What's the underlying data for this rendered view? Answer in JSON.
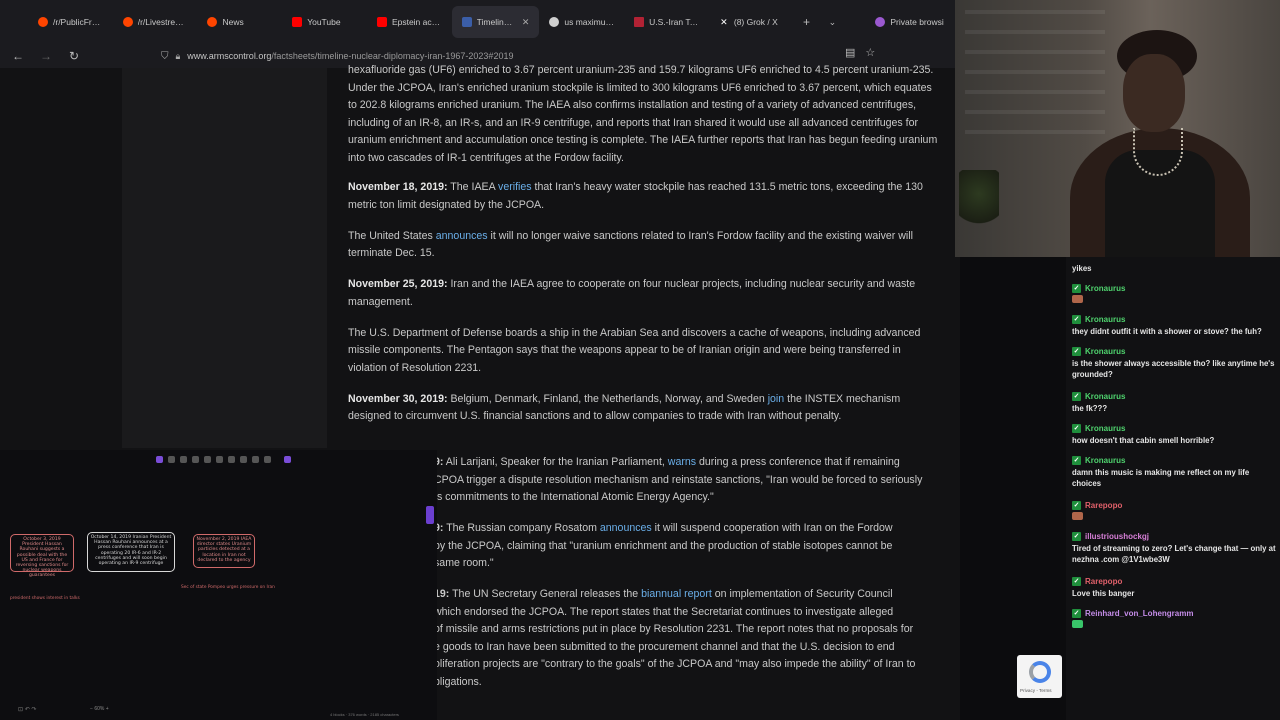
{
  "tabs": [
    {
      "label": "/r/PublicFreakout",
      "color": "#ff4500",
      "active": false
    },
    {
      "label": "/r/LivestreamFail",
      "color": "#ff4500",
      "active": false
    },
    {
      "label": "News",
      "color": "#ff4500",
      "active": false
    },
    {
      "label": "YouTube",
      "color": "#ff0000",
      "active": false
    },
    {
      "label": "Epstein accuser",
      "color": "#ff0000",
      "active": false
    },
    {
      "label": "Timeline of N",
      "color": "#3b5ea8",
      "active": true
    },
    {
      "label": "us maximum pr",
      "color": "#cfcfcf",
      "active": false
    },
    {
      "label": "U.S.-Iran Tensio",
      "color": "#b22234",
      "active": false
    },
    {
      "label": "(8) Grok / X",
      "color": "#ffffff",
      "active": false
    }
  ],
  "private_label": "Private browsi",
  "url": {
    "domain": "www.armscontrol.org",
    "path": "/factsheets/timeline-nuclear-diplomacy-iran-1967-2023#2019"
  },
  "article": {
    "p0": "hexafluoride gas (UF6) enriched to 3.67 percent uranium-235 and 159.7 kilograms UF6 enriched to 4.5 percent uranium-235. Under the JCPOA, Iran's enriched uranium stockpile is limited to 300 kilograms UF6 enriched to 3.67 percent, which equates to 202.8 kilograms enriched uranium. The IAEA also confirms installation and testing of a variety of advanced centrifuges, including of an IR-8, an IR-s, and an IR-9 centrifuge, and reports that Iran shared it would use all advanced centrifuges for uranium enrichment and accumulation once testing is complete. The IAEA further reports that Iran has begun feeding uranium into two cascades of IR-1 centrifuges at the Fordow facility.",
    "p1_date": "November 18, 2019:",
    "p1_a": "The IAEA",
    "p1_link": "verifies",
    "p1_b": "that Iran's heavy water stockpile has reached 131.5 metric tons, exceeding the 130 metric ton limit designated by the JCPOA.",
    "p2_a": "The United States",
    "p2_link": "announces",
    "p2_b": "it will no longer waive sanctions related to Iran's Fordow facility and the existing waiver will terminate Dec. 15.",
    "p3_date": "November 25, 2019:",
    "p3_text": "Iran and the IAEA agree to cooperate on four nuclear projects, including nuclear security and waste management.",
    "p4_text": "The U.S. Department of Defense boards a ship in the Arabian Sea and discovers a cache of weapons, including advanced missile components. The Pentagon says that the weapons appear to be of Iranian origin and were being transferred in violation of Resolution 2231.",
    "p5_date": "November 30, 2019:",
    "p5_a": "Belgium, Denmark, Finland, the Netherlands, Norway, and Sweden",
    "p5_link": "join",
    "p5_b": "the INSTEX mechanism designed to circumvent U.S. financial sanctions and to allow companies to trade with Iran without penalty.",
    "p6_date": "9:",
    "p6_a": "Ali Larijani, Speaker for the Iranian Parliament,",
    "p6_link": "warns",
    "p6_b": "during a press conference that if remaining",
    "p6_c": "CPOA trigger a dispute resolution mechanism and reinstate sanctions, \"Iran would be forced to seriously",
    "p6_d": "ts commitments to the International Atomic Energy Agency.\"",
    "p7_date": "9:",
    "p7_a": "The Russian company Rosatom",
    "p7_link": "announces",
    "p7_b": "it will suspend cooperation with Iran on the Fordow",
    "p7_c": "by the JCPOA, claiming that \"uranium enrichment and the production of stable isotopes cannot be",
    "p7_d": "same room.\"",
    "p8_date": "19:",
    "p8_a": "The UN Secretary General releases the",
    "p8_link": "biannual report",
    "p8_b": "on implementation of Security Council",
    "p8_c": "which endorsed the JCPOA. The report states that the Secretariat continues to investigate alleged",
    "p8_d": "of missile and arms restrictions put in place by Resolution 2231. The report notes that no proposals for",
    "p8_e": "e goods to Iran have been submitted to the procurement channel and that the U.S. decision to end",
    "p8_f": "oliferation projects are \"contrary to the goals\" of the JCPOA and \"may also impede the ability\" of Iran to",
    "p8_g": "bligations."
  },
  "board": {
    "note1": "October 3, 2019 President Hassan Rouhani suggests a possible deal with the US and France for reversing sanctions for nuclear weapons guarantees",
    "note2": "October 14, 2019 Iranian President Hassan Rouhani announces at a press conference that Iran is operating 20 IR-6 and IR-2 centrifuges and will soon begin operating an IR-9 centrifuge",
    "note3": "November 2, 2019 IAEA director states Uranium particles detected at a location in Iran not declared to the agency",
    "cap1": "president shows interest in talks",
    "cap3": "Sec of state Pompeo urges pressure on Iran",
    "zoom": "60%",
    "footer": "4 blocks · 376 words · 2185 characters"
  },
  "chat": [
    {
      "type": "msg",
      "text": "yikes"
    },
    {
      "type": "user",
      "name": "Kronaurus",
      "color": "#4fd36e"
    },
    {
      "type": "emote",
      "color": "#b0664a"
    },
    {
      "type": "user",
      "name": "Kronaurus",
      "color": "#4fd36e"
    },
    {
      "type": "msg",
      "text": "they didnt outfit it with a shower or stove? the fuh?"
    },
    {
      "type": "user",
      "name": "Kronaurus",
      "color": "#4fd36e"
    },
    {
      "type": "msg",
      "text": "is the shower always accessible tho? like anytime he's grounded?"
    },
    {
      "type": "user",
      "name": "Kronaurus",
      "color": "#4fd36e"
    },
    {
      "type": "msg",
      "text": "the fk???"
    },
    {
      "type": "user",
      "name": "Kronaurus",
      "color": "#4fd36e"
    },
    {
      "type": "msg",
      "text": "how doesn't that cabin smell horrible?"
    },
    {
      "type": "user",
      "name": "Kronaurus",
      "color": "#4fd36e"
    },
    {
      "type": "msg",
      "text": "damn this music is making me reflect on my life choices"
    },
    {
      "type": "user",
      "name": "Rarepopo",
      "color": "#e0606a"
    },
    {
      "type": "emote",
      "color": "#b0664a"
    },
    {
      "type": "user",
      "name": "illustrioushockgj",
      "color": "#d77fd7"
    },
    {
      "type": "msg",
      "text": "Tired of streaming to zero? Let's change that — only at nezhna .com @1V1wbe3W"
    },
    {
      "type": "user",
      "name": "Rarepopo",
      "color": "#e0606a"
    },
    {
      "type": "msg",
      "text": "Love this banger"
    },
    {
      "type": "user",
      "name": "Reinhard_von_Lohengramm",
      "color": "#c48ce8"
    },
    {
      "type": "emote",
      "color": "#39c56a"
    }
  ],
  "recaptcha_text": "Privacy - Terms"
}
